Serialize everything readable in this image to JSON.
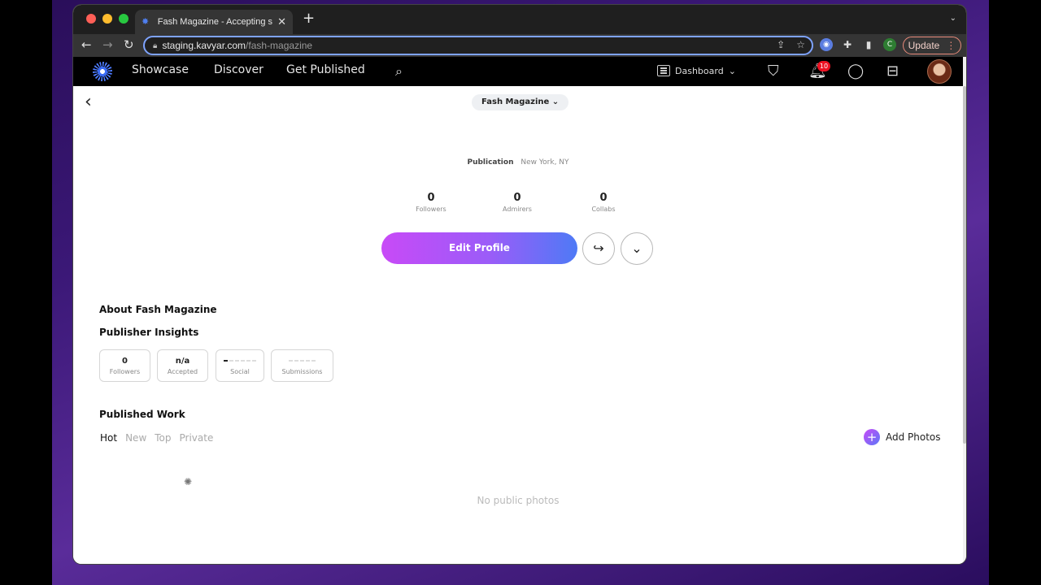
{
  "browser": {
    "tab_title": "Fash Magazine - Accepting su",
    "tab_close": "✕",
    "new_tab": "+",
    "url_host": "staging.kavyar.com",
    "url_path": "/fash-magazine",
    "update_label": "Update",
    "profile_initial": "C"
  },
  "appnav": {
    "links": [
      "Showcase",
      "Discover",
      "Get Published"
    ],
    "dashboard_label": "Dashboard",
    "notification_count": "10"
  },
  "profile": {
    "chip_label": "Fash Magazine",
    "type": "Publication",
    "location": "New York, NY",
    "stats": [
      {
        "value": "0",
        "label": "Followers"
      },
      {
        "value": "0",
        "label": "Admirers"
      },
      {
        "value": "0",
        "label": "Collabs"
      }
    ],
    "edit_button": "Edit Profile"
  },
  "sections": {
    "about_title": "About Fash Magazine",
    "insights_title": "Publisher Insights",
    "insights": [
      {
        "value": "0",
        "label": "Followers"
      },
      {
        "value": "n/a",
        "label": "Accepted"
      },
      {
        "value": "",
        "label": "Social"
      },
      {
        "value": "",
        "label": "Submissions"
      }
    ],
    "social_level": 1,
    "submissions_level": 0,
    "work_title": "Published Work",
    "tabs": [
      "Hot",
      "New",
      "Top",
      "Private"
    ],
    "active_tab": "Hot",
    "add_photos": "Add Photos",
    "empty_state": "No public photos"
  },
  "colors": {
    "accent_start": "#c84af7",
    "accent_end": "#4e7af6",
    "badge": "#ee1122"
  }
}
